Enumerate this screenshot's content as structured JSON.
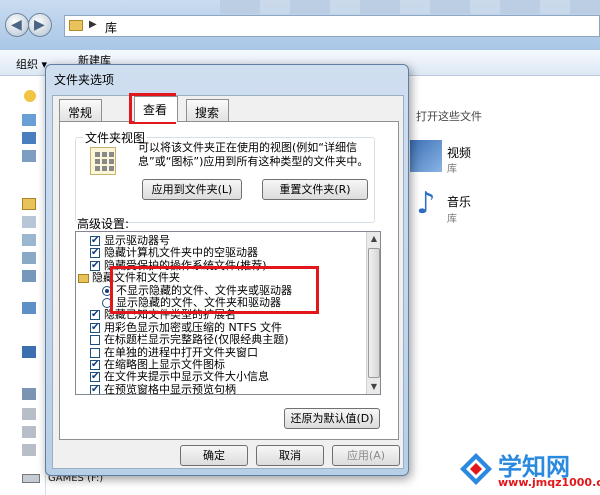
{
  "explorer": {
    "path": "库",
    "toolbar": {
      "organize": "组织 ▾",
      "new_folder": "新建库"
    },
    "lib_hint": "打开这些文件",
    "libraries": [
      {
        "name": "视频",
        "sub": "库",
        "icon": "video-library-icon"
      },
      {
        "name": "音乐",
        "sub": "库",
        "icon": "music-library-icon"
      }
    ],
    "drive": "GAMES (F:)"
  },
  "dialog": {
    "title": "文件夹选项",
    "tabs": [
      "常规",
      "查看",
      "搜索"
    ],
    "active_tab": "查看",
    "folder_view": {
      "label": "文件夹视图",
      "desc": "可以将该文件夹正在使用的视图(例如“详细信息”或“图标”)应用到所有这种类型的文件夹中。",
      "apply_btn": "应用到文件夹(L)",
      "reset_btn": "重置文件夹(R)"
    },
    "advanced_label": "高级设置:",
    "advanced": [
      {
        "type": "checkbox",
        "checked": true,
        "text": "显示驱动器号",
        "indent": 1
      },
      {
        "type": "checkbox",
        "checked": true,
        "text": "隐藏计算机文件夹中的空驱动器",
        "indent": 1
      },
      {
        "type": "checkbox",
        "checked": true,
        "text": "隐藏受保护的操作系统文件(推荐)",
        "indent": 1
      },
      {
        "type": "folder",
        "text": "隐藏文件和文件夹",
        "indent": 0
      },
      {
        "type": "radio",
        "checked": true,
        "text": "不显示隐藏的文件、文件夹或驱动器",
        "indent": 2
      },
      {
        "type": "radio",
        "checked": false,
        "text": "显示隐藏的文件、文件夹和驱动器",
        "indent": 2
      },
      {
        "type": "checkbox",
        "checked": true,
        "text": "隐藏已知文件类型的扩展名",
        "indent": 1
      },
      {
        "type": "checkbox",
        "checked": true,
        "text": "用彩色显示加密或压缩的 NTFS 文件",
        "indent": 1
      },
      {
        "type": "checkbox",
        "checked": false,
        "text": "在标题栏显示完整路径(仅限经典主题)",
        "indent": 1
      },
      {
        "type": "checkbox",
        "checked": false,
        "text": "在单独的进程中打开文件夹窗口",
        "indent": 1
      },
      {
        "type": "checkbox",
        "checked": true,
        "text": "在缩略图上显示文件图标",
        "indent": 1
      },
      {
        "type": "checkbox",
        "checked": true,
        "text": "在文件夹提示中显示文件大小信息",
        "indent": 1
      },
      {
        "type": "checkbox",
        "checked": true,
        "text": "在预览窗格中显示预览句柄",
        "indent": 1
      }
    ],
    "restore_btn": "还原为默认值(D)",
    "ok_btn": "确定",
    "cancel_btn": "取消",
    "apply_btn": "应用(A)"
  },
  "watermark": {
    "name": "学知网",
    "url": "www.jmqz1000.com"
  },
  "colors": {
    "highlight": "#e2171b",
    "accent": "#2a8ae0"
  }
}
